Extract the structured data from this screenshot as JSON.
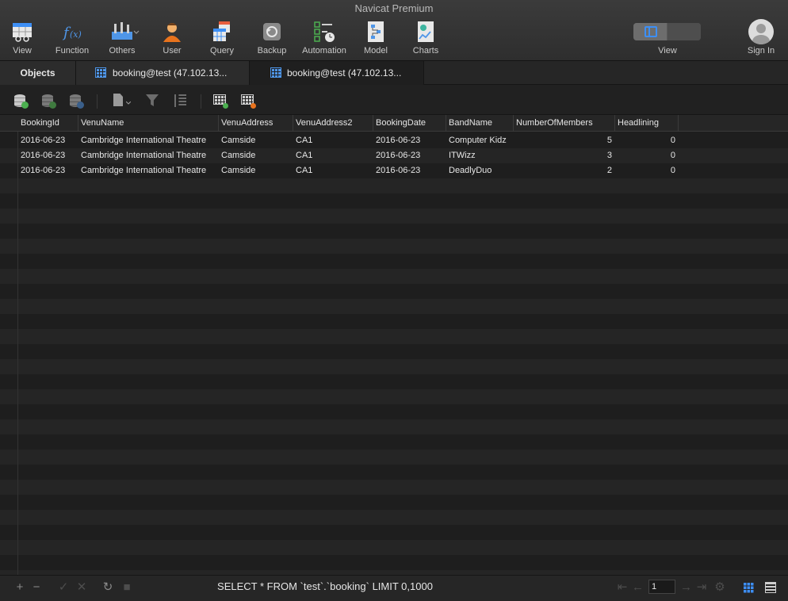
{
  "app_title": "Navicat Premium",
  "toolbar": {
    "items": [
      {
        "label": "View",
        "icon": "view-grid-icon"
      },
      {
        "label": "Function",
        "icon": "function-fx-icon"
      },
      {
        "label": "Others",
        "icon": "others-tools-icon"
      },
      {
        "label": "User",
        "icon": "user-icon"
      },
      {
        "label": "Query",
        "icon": "query-icon"
      },
      {
        "label": "Backup",
        "icon": "backup-icon"
      },
      {
        "label": "Automation",
        "icon": "automation-icon"
      },
      {
        "label": "Model",
        "icon": "model-icon"
      },
      {
        "label": "Charts",
        "icon": "charts-icon"
      }
    ],
    "view_toggle_label": "View",
    "sign_in_label": "Sign In"
  },
  "tabs": {
    "objects": "Objects",
    "tab1": "booking@test (47.102.13...",
    "tab2": "booking@test (47.102.13..."
  },
  "grid": {
    "columns": [
      "BookingId",
      "VenuName",
      "VenuAddress",
      "VenuAddress2",
      "BookingDate",
      "BandName",
      "NumberOfMembers",
      "Headlining"
    ],
    "rows": [
      [
        "2016-06-23",
        "Cambridge International Theatre",
        "Camside",
        "CA1",
        "2016-06-23",
        "Computer Kidz",
        "5",
        "0"
      ],
      [
        "2016-06-23",
        "Cambridge International Theatre",
        "Camside",
        "CA1",
        "2016-06-23",
        "ITWizz",
        "3",
        "0"
      ],
      [
        "2016-06-23",
        "Cambridge International Theatre",
        "Camside",
        "CA1",
        "2016-06-23",
        "DeadlyDuo",
        "2",
        "0"
      ]
    ]
  },
  "status": {
    "sql": "SELECT * FROM `test`.`booking` LIMIT 0,1000",
    "page": "1"
  },
  "colors": {
    "accent": "#3d8ff5",
    "background": "#1e1e1e"
  }
}
